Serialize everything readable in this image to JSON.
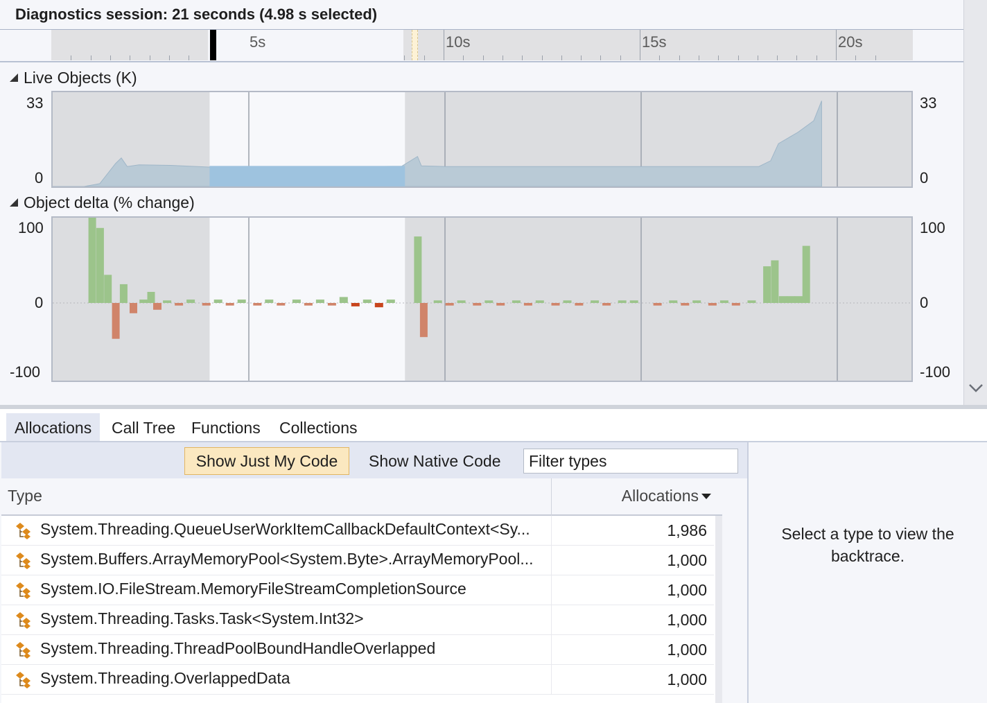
{
  "session": {
    "title": "Diagnostics session: 21 seconds (4.98 s selected)"
  },
  "timeline": {
    "ticks": [
      "5s",
      "10s",
      "15s",
      "20s"
    ],
    "duration_s": 21,
    "selection_start_s": 4.0,
    "selection_end_s": 8.98
  },
  "live_objects": {
    "header": "Live Objects (K)",
    "y_max": "33",
    "y_min": "0",
    "right_y_max": "33",
    "right_y_min": "0"
  },
  "object_delta": {
    "header": "Object delta (% change)",
    "y_max": "100",
    "y_mid": "0",
    "y_min": "-100",
    "right_y_max": "100",
    "right_y_mid": "0",
    "right_y_min": "-100"
  },
  "chart_data": [
    {
      "type": "area",
      "title": "Live Objects (K)",
      "xlabel": "",
      "ylabel": "",
      "xlim": [
        0,
        21
      ],
      "ylim": [
        0,
        33
      ],
      "x": [
        0,
        0.8,
        1.2,
        1.6,
        1.75,
        1.9,
        2.2,
        3.0,
        4.0,
        5.0,
        6.0,
        7.0,
        8.0,
        8.9,
        9.3,
        9.4,
        10.0,
        12.0,
        14.0,
        16.0,
        18.0,
        18.3,
        18.5,
        19.0,
        19.4,
        19.6
      ],
      "values": [
        0,
        0,
        1,
        8,
        10,
        7,
        7.6,
        7.4,
        6.8,
        7.0,
        7.0,
        6.9,
        7.0,
        7.1,
        10.5,
        7.2,
        7.0,
        7.0,
        7.0,
        7.0,
        7.0,
        9,
        15,
        19,
        23,
        30
      ]
    },
    {
      "type": "bar",
      "title": "Object delta (% change)",
      "xlabel": "",
      "ylabel": "",
      "xlim": [
        0,
        21
      ],
      "ylim": [
        -100,
        100
      ],
      "x": [
        1.0,
        1.2,
        1.4,
        1.6,
        1.8,
        2.05,
        2.3,
        2.5,
        2.65,
        2.9,
        3.2,
        3.5,
        3.9,
        4.2,
        4.5,
        4.8,
        5.2,
        5.5,
        5.8,
        6.2,
        6.5,
        6.8,
        7.1,
        7.4,
        7.7,
        8.0,
        8.3,
        8.6,
        9.3,
        9.45,
        9.8,
        10.1,
        10.4,
        10.8,
        11.1,
        11.4,
        11.8,
        12.1,
        12.4,
        12.8,
        13.1,
        13.4,
        13.8,
        14.1,
        14.5,
        14.8,
        15.4,
        15.8,
        16.1,
        16.4,
        16.8,
        17.1,
        17.4,
        17.8,
        18.2,
        18.4,
        18.6,
        18.8,
        19.0,
        19.2
      ],
      "values": [
        100,
        88,
        33,
        -42,
        22,
        -12,
        4,
        13,
        -8,
        3,
        -3,
        4,
        -3,
        4,
        -3,
        4,
        -3,
        4,
        -3,
        4,
        -3,
        4,
        -3,
        7,
        -4,
        4,
        -5,
        4,
        78,
        -40,
        3,
        -3,
        3,
        -3,
        3,
        -3,
        3,
        -3,
        3,
        -3,
        3,
        -3,
        3,
        -3,
        3,
        3,
        -3,
        3,
        -3,
        3,
        -3,
        3,
        -3,
        3,
        43,
        50,
        8,
        8,
        8,
        67
      ]
    }
  ],
  "tabs": [
    "Allocations",
    "Call Tree",
    "Functions",
    "Collections"
  ],
  "toolbar": {
    "just_my_code": "Show Just My Code",
    "native_code": "Show Native Code",
    "filter_placeholder": "Filter types"
  },
  "grid": {
    "col_type": "Type",
    "col_allocations": "Allocations",
    "rows": [
      {
        "type": "System.Threading.QueueUserWorkItemCallbackDefaultContext<Sy...",
        "allocations": "1,986"
      },
      {
        "type": "System.Buffers.ArrayMemoryPool<System.Byte>.ArrayMemoryPool...",
        "allocations": "1,000"
      },
      {
        "type": "System.IO.FileStream.MemoryFileStreamCompletionSource",
        "allocations": "1,000"
      },
      {
        "type": "System.Threading.Tasks.Task<System.Int32>",
        "allocations": "1,000"
      },
      {
        "type": "System.Threading.ThreadPoolBoundHandleOverlapped",
        "allocations": "1,000"
      },
      {
        "type": "System.Threading.OverlappedData",
        "allocations": "1,000"
      }
    ]
  },
  "detail": {
    "message": "Select a type to view the backtrace."
  },
  "colors": {
    "area_fill": "#b9cad6",
    "area_selected": "#9ec3df",
    "positive_bar": "#9cc48b",
    "negative_bar": "#d0846a",
    "negative_bar_selected": "#c8451d",
    "accent_button": "#fbe8c0",
    "icon": "#dd8a1c"
  }
}
